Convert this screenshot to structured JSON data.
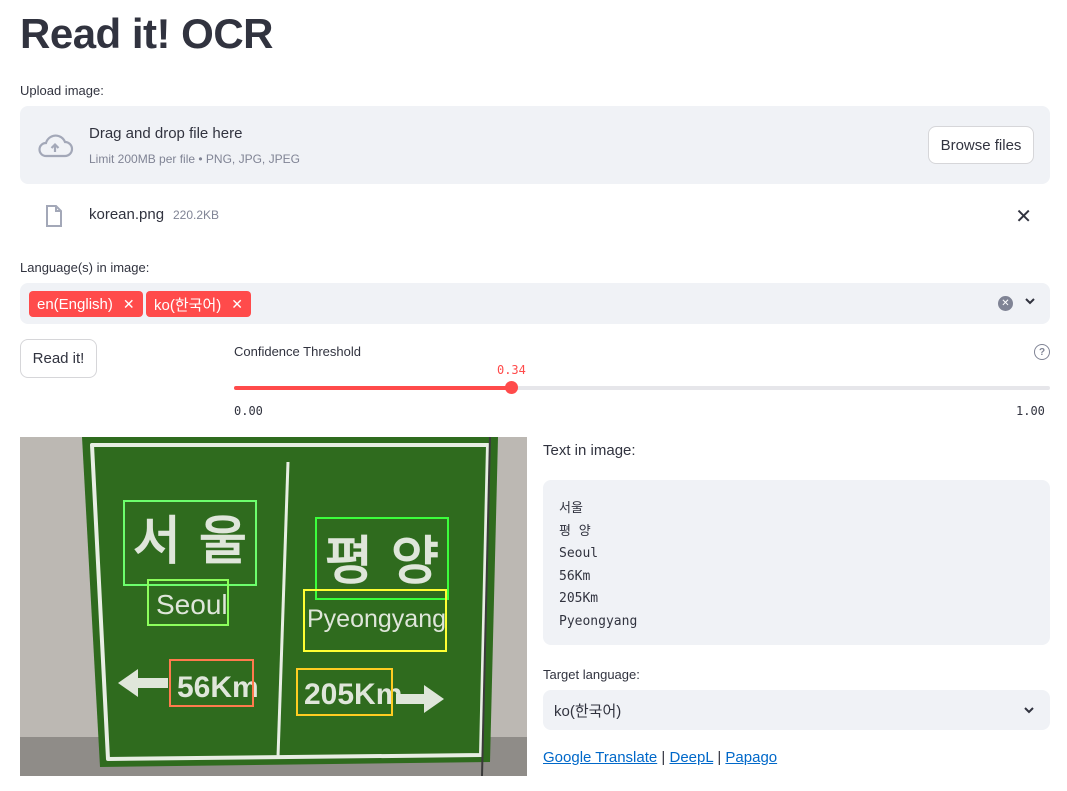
{
  "title": "Read it! OCR",
  "upload": {
    "label": "Upload image:",
    "drop_text": "Drag and drop file here",
    "limit_text": "Limit 200MB per file • PNG, JPG, JPEG",
    "browse_label": "Browse files",
    "file_name": "korean.png",
    "file_size": "220.2KB"
  },
  "languages": {
    "label": "Language(s) in image:",
    "chips": [
      "en(English)",
      "ko(한국어)"
    ]
  },
  "read_button": "Read it!",
  "slider": {
    "label": "Confidence Threshold",
    "value": 0.34,
    "value_text": "0.34",
    "min": "0.00",
    "max": "1.00"
  },
  "sign_image": {
    "texts": [
      "서 울",
      "평 양",
      "Seoul",
      "Pyeongyang",
      "56Km",
      "205Km"
    ],
    "colors": {
      "green": "#2f6b1e",
      "accent": "#ff4b4b"
    }
  },
  "text_in_image": {
    "label": "Text in image:",
    "lines": [
      "서울",
      "평 양",
      "Seoul",
      "56Km",
      "205Km",
      "Pyeongyang"
    ]
  },
  "target_language": {
    "label": "Target language:",
    "value": "ko(한국어)"
  },
  "links": {
    "google": "Google Translate",
    "sep1": "|",
    "deepl": "DeepL",
    "sep2": "|",
    "papago": "Papago"
  }
}
